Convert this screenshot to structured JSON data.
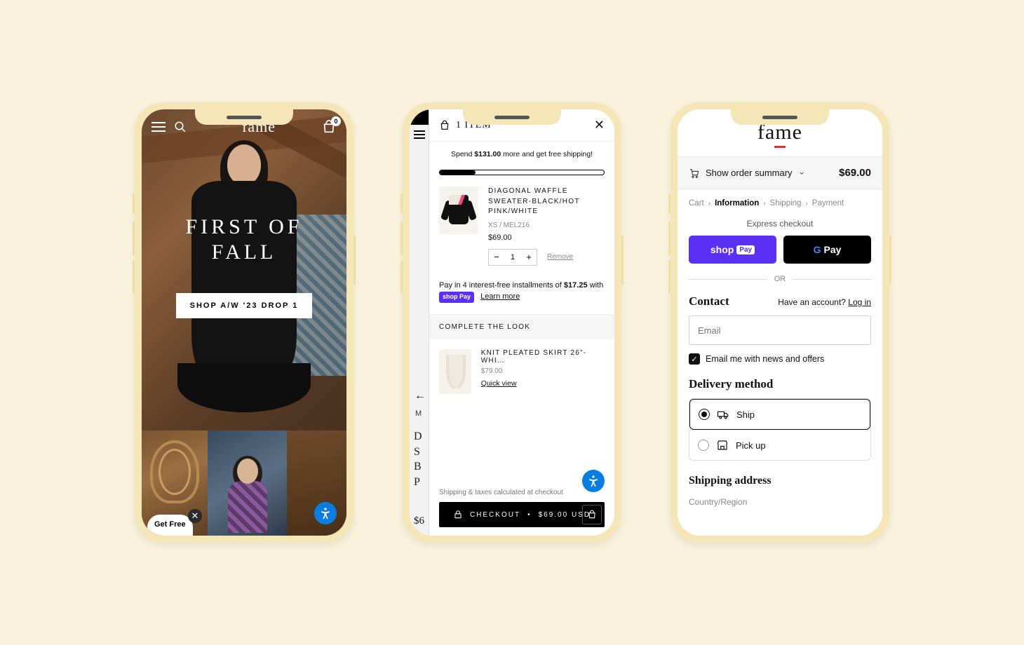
{
  "phone1": {
    "logo": "fame",
    "bag_count": "0",
    "hero_line1": "FIRST OF",
    "hero_line2": "FALL",
    "cta": "SHOP A/W '23 DROP 1",
    "pill": "Get Free"
  },
  "phone2": {
    "title": "1 ITEM",
    "shipping_msg_a": "Spend ",
    "shipping_amount": "$131.00",
    "shipping_msg_b": " more and get free shipping!",
    "item": {
      "name": "DIAGONAL WAFFLE SWEATER-BLACK/HOT PINK/WHITE",
      "variant": "XS / MEL216",
      "price": "$69.00",
      "qty": "1"
    },
    "remove": "Remove",
    "installments_a": "Pay in 4 interest-free installments of ",
    "installments_amt": "$17.25",
    "installments_b": " with ",
    "shoppay": "shop Pay",
    "learn": "Learn more",
    "ctl": "COMPLETE THE LOOK",
    "rec": {
      "name": "KNIT PLEATED SKIRT 26\"-WHI…",
      "price": "$79.00",
      "quick": "Quick view"
    },
    "peek_M": "M",
    "peek_letters": "D\nS\nB\nP",
    "peek_price": "$6",
    "calc": "Shipping & taxes calculated at checkout",
    "checkout": "CHECKOUT",
    "checkout_sep": "•",
    "checkout_price": "$69.00 USD"
  },
  "phone3": {
    "logo": "fame",
    "summary_label": "Show order summary",
    "total": "$69.00",
    "crumbs": {
      "cart": "Cart",
      "info": "Information",
      "ship": "Shipping",
      "pay": "Payment"
    },
    "express": "Express checkout",
    "shop_btn": "shop Pay",
    "gpay_btn": "G Pay",
    "or": "OR",
    "contact": "Contact",
    "have_account": "Have an account? ",
    "login": "Log in",
    "email_placeholder": "Email",
    "newsletter": "Email me with news and offers",
    "delivery": "Delivery method",
    "ship_opt": "Ship",
    "pickup_opt": "Pick up",
    "ship_addr": "Shipping address",
    "country": "Country/Region"
  }
}
